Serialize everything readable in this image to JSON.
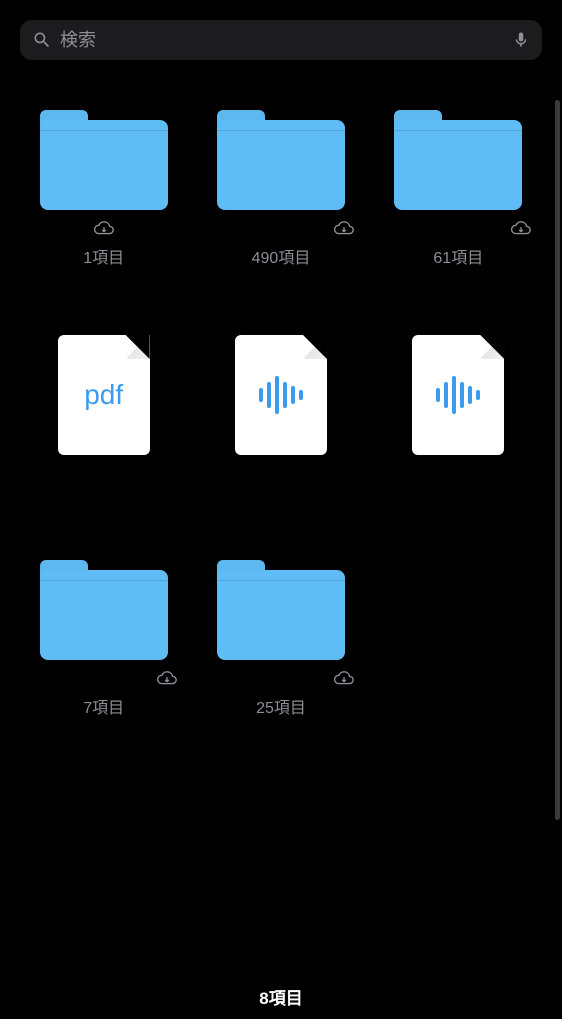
{
  "search": {
    "placeholder": "検索"
  },
  "items": [
    {
      "type": "folder",
      "subtitle": "1項目",
      "cloud": "center"
    },
    {
      "type": "folder",
      "subtitle": "490項目",
      "cloud": "right"
    },
    {
      "type": "folder",
      "subtitle": "61項目",
      "cloud": "right"
    },
    {
      "type": "file-pdf",
      "label": "pdf"
    },
    {
      "type": "file-audio"
    },
    {
      "type": "file-audio"
    },
    {
      "type": "folder",
      "subtitle": "7項目",
      "cloud": "right"
    },
    {
      "type": "folder",
      "subtitle": "25項目",
      "cloud": "right"
    }
  ],
  "footer": {
    "count_label": "8項目"
  },
  "colors": {
    "folder": "#60bcf4",
    "accent": "#3a9bf0",
    "muted": "#8e8e93",
    "background": "#000000",
    "search_bg": "#1c1c1e"
  }
}
